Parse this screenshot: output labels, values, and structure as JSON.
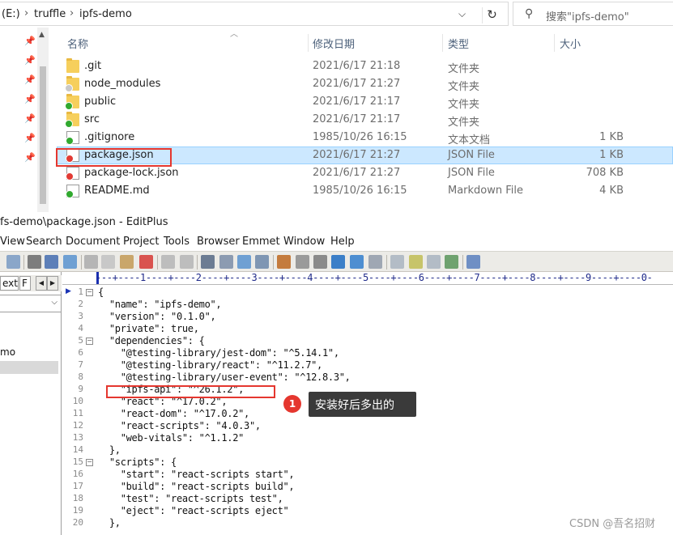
{
  "explorer": {
    "breadcrumbs": [
      "(E:)",
      "truffle",
      "ipfs-demo"
    ],
    "breadcrumb_separator": "›",
    "search_placeholder": "搜索\"ipfs-demo\"",
    "columns": {
      "name": "名称",
      "modified": "修改日期",
      "type": "类型",
      "size": "大小"
    },
    "files": [
      {
        "name": ".git",
        "modified": "2021/6/17 21:18",
        "type": "文件夹",
        "size": "",
        "icon": "folder-icon"
      },
      {
        "name": "node_modules",
        "modified": "2021/6/17 21:27",
        "type": "文件夹",
        "size": "",
        "icon": "folder-icon"
      },
      {
        "name": "public",
        "modified": "2021/6/17 21:17",
        "type": "文件夹",
        "size": "",
        "icon": "folder-icon"
      },
      {
        "name": "src",
        "modified": "2021/6/17 21:17",
        "type": "文件夹",
        "size": "",
        "icon": "folder-icon"
      },
      {
        "name": ".gitignore",
        "modified": "1985/10/26 16:15",
        "type": "文本文档",
        "size": "1 KB",
        "icon": "text-file-icon"
      },
      {
        "name": "package.json",
        "modified": "2021/6/17 21:27",
        "type": "JSON File",
        "size": "1 KB",
        "icon": "json-file-icon",
        "selected": true
      },
      {
        "name": "package-lock.json",
        "modified": "2021/6/17 21:27",
        "type": "JSON File",
        "size": "708 KB",
        "icon": "json-file-icon"
      },
      {
        "name": "README.md",
        "modified": "1985/10/26 16:15",
        "type": "Markdown File",
        "size": "4 KB",
        "icon": "markdown-file-icon"
      }
    ]
  },
  "editplus": {
    "title": "fs-demo\\package.json - EditPlus",
    "menu": [
      "View",
      "Search",
      "Document",
      "Project",
      "Tools",
      "Browser",
      "Emmet",
      "Window",
      "Help"
    ],
    "left_panel": {
      "tab1": "ext",
      "tab2": "F",
      "tree_item": "mo"
    },
    "ruler": "---+----1----+----2----+----3----+----4----+----5----+----6----+----7----+----8----+----9----+----0-",
    "lines": [
      {
        "n": "1",
        "text": "{"
      },
      {
        "n": "2",
        "text": "  \"name\": \"ipfs-demo\","
      },
      {
        "n": "3",
        "text": "  \"version\": \"0.1.0\","
      },
      {
        "n": "4",
        "text": "  \"private\": true,"
      },
      {
        "n": "5",
        "text": "  \"dependencies\": {"
      },
      {
        "n": "6",
        "text": "    \"@testing-library/jest-dom\": \"^5.14.1\","
      },
      {
        "n": "7",
        "text": "    \"@testing-library/react\": \"^11.2.7\","
      },
      {
        "n": "8",
        "text": "    \"@testing-library/user-event\": \"^12.8.3\","
      },
      {
        "n": "9",
        "text": "    \"ipfs-api\": \"^26.1.2\","
      },
      {
        "n": "10",
        "text": "    \"react\": \"^17.0.2\","
      },
      {
        "n": "11",
        "text": "    \"react-dom\": \"^17.0.2\","
      },
      {
        "n": "12",
        "text": "    \"react-scripts\": \"4.0.3\","
      },
      {
        "n": "13",
        "text": "    \"web-vitals\": \"^1.1.2\""
      },
      {
        "n": "14",
        "text": "  },"
      },
      {
        "n": "15",
        "text": "  \"scripts\": {"
      },
      {
        "n": "16",
        "text": "    \"start\": \"react-scripts start\","
      },
      {
        "n": "17",
        "text": "    \"build\": \"react-scripts build\","
      },
      {
        "n": "18",
        "text": "    \"test\": \"react-scripts test\","
      },
      {
        "n": "19",
        "text": "    \"eject\": \"react-scripts eject\""
      },
      {
        "n": "20",
        "text": "  },"
      }
    ],
    "fold_lines": [
      1,
      5,
      15
    ]
  },
  "annotation": {
    "number": "1",
    "text": "安装好后多出的"
  },
  "watermark": "CSDN @吾名招财",
  "colors": {
    "highlight": "#e5372f",
    "selection": "#cce8ff",
    "ruler": "#1f2a8a"
  }
}
